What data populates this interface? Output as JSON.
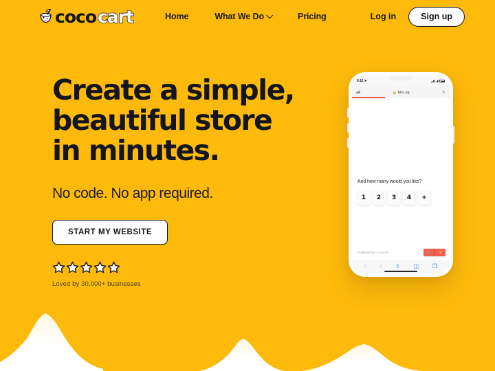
{
  "brand": {
    "icon": "coconut-drink-icon",
    "name_primary": "coco",
    "name_secondary": "cart"
  },
  "nav": {
    "links": [
      {
        "label": "Home",
        "has_chevron": false
      },
      {
        "label": "What We Do",
        "has_chevron": true
      },
      {
        "label": "Pricing",
        "has_chevron": false
      }
    ],
    "login_label": "Log in",
    "signup_label": "Sign up"
  },
  "hero": {
    "headline": "Create a simple,\nbeautiful store\nin minutes.",
    "subhead": "No code. No app required.",
    "cta_label": "START MY WEBSITE",
    "rating_stars": 5,
    "social_proof": "Loved by 30,000+ businesses"
  },
  "phone": {
    "status": {
      "time": "6:12",
      "location_icon": "location-arrow-icon",
      "signal_icon": "cellular-signal-icon",
      "wifi_icon": "wifi-icon",
      "battery_icon": "battery-icon"
    },
    "browser": {
      "text_size_label": "ᴀA",
      "lock_icon": "lock-icon",
      "url": "bbc.sg",
      "reload_icon": "reload-icon",
      "load_progress": "34"
    },
    "store": {
      "question": "And how many would you like?",
      "quantity_options": [
        "1",
        "2",
        "3",
        "4",
        "+"
      ],
      "powered_by": "Powered by Cococart",
      "cart_left_icon": "cart-icon",
      "cart_right_icon": "chevron-down-icon",
      "cart_color": "#f0604a"
    },
    "toolbar": [
      {
        "name": "back-icon",
        "glyph": "‹",
        "dim": true
      },
      {
        "name": "forward-icon",
        "glyph": "›",
        "dim": true
      },
      {
        "name": "share-icon",
        "glyph": "⇧",
        "dim": false
      },
      {
        "name": "bookmarks-icon",
        "glyph": "◫",
        "dim": false
      },
      {
        "name": "tabs-icon",
        "glyph": "❐",
        "dim": false
      }
    ]
  },
  "theme": {
    "background": "#FDBA0B",
    "ink": "#15151f",
    "white": "#ffffff"
  }
}
